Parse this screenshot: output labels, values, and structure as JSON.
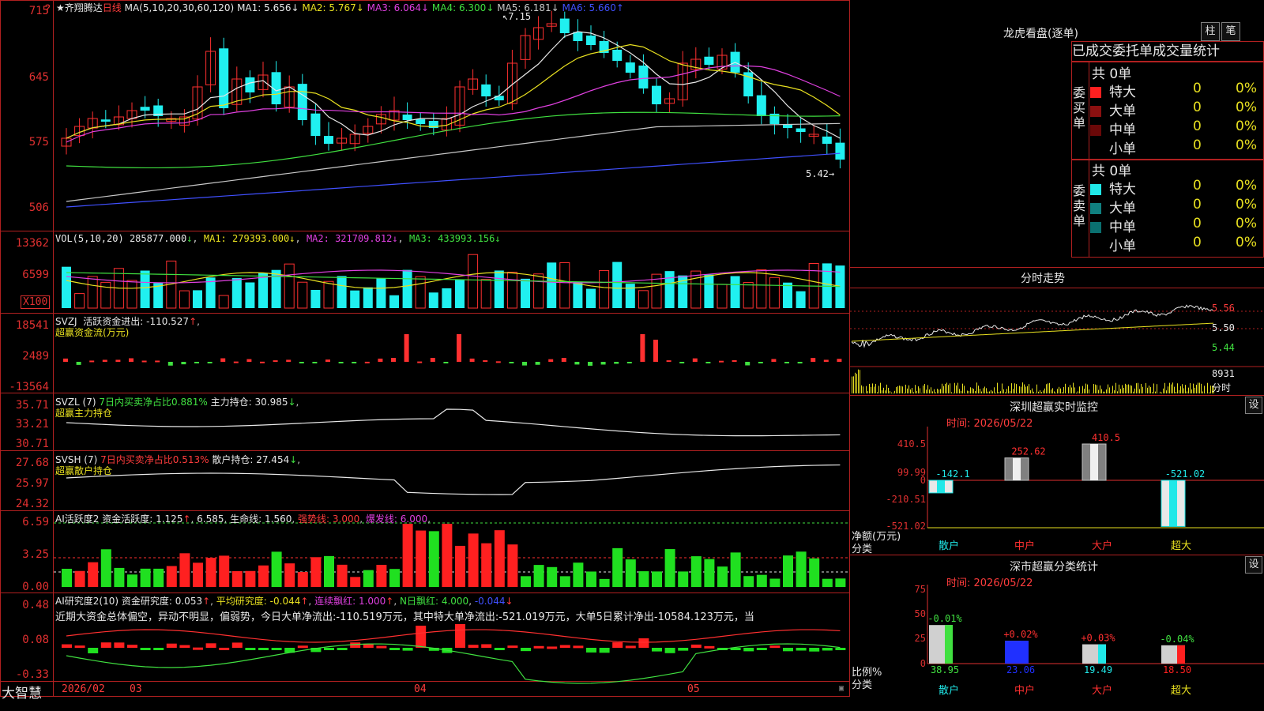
{
  "main_chart": {
    "title": "★齐翔腾达",
    "period": "日线",
    "ma_label": "MA(5,10,20,30,60,120)",
    "ma": [
      {
        "name": "MA1",
        "value": "5.656",
        "arrow": "↓",
        "color": "#e8e8e8"
      },
      {
        "name": "MA2",
        "value": "5.767",
        "arrow": "↓",
        "color": "#e8e020"
      },
      {
        "name": "MA3",
        "value": "6.064",
        "arrow": "↓",
        "color": "#e040e0"
      },
      {
        "name": "MA4",
        "value": "6.300",
        "arrow": "↓",
        "color": "#40e040"
      },
      {
        "name": "MA5",
        "value": "6.181",
        "arrow": "↓",
        "color": "#c8c8c8"
      },
      {
        "name": "MA6",
        "value": "5.660",
        "arrow": "↑",
        "color": "#4050ff"
      }
    ],
    "y_ticks": [
      "715",
      "645",
      "575",
      "506"
    ],
    "high_mark": "7.15",
    "low_mark": "5.42→",
    "question": "?"
  },
  "vol": {
    "label": "VOL(5,10,20)",
    "value": "285877.000",
    "ma1": "279393.000",
    "ma2": "321709.812",
    "ma3": "433993.156",
    "y_ticks": [
      "13362",
      "6599"
    ],
    "unit": "X100"
  },
  "svzj": {
    "label": "SVZJ",
    "desc": "活跃资金进出:",
    "value": "-110.527",
    "sub": "超赢资金流(万元)",
    "y_ticks": [
      "18541",
      "2489",
      "-13564"
    ]
  },
  "svzl": {
    "label": "SVZL (7)",
    "desc": "7日内买卖净占比0.881%",
    "pos_label": "主力持仓:",
    "pos_value": "30.985",
    "sub": "超赢主力持仓",
    "y_ticks": [
      "35.71",
      "33.21",
      "30.71"
    ]
  },
  "svsh": {
    "label": "SVSH (7)",
    "desc": "7日内买卖净占比0.513%",
    "pos_label": "散户持仓:",
    "pos_value": "27.454",
    "sub": "超赢散户持仓",
    "y_ticks": [
      "27.68",
      "25.97",
      "24.32"
    ]
  },
  "ai_active": {
    "label": "AI活跃度2",
    "desc": "资金活跃度:",
    "value": "1.125",
    "v2": "6.585",
    "life_label": "生命线:",
    "life": "1.560",
    "strong": "强势线: 3.000",
    "burst": "爆发线: 6.000",
    "y_ticks": [
      "6.59",
      "3.25",
      "0.00"
    ]
  },
  "ai_research": {
    "label": "AI研究度2(10)",
    "desc": "资金研究度:",
    "value": "0.053",
    "avg_label": "平均研究度:",
    "avg": "-0.044",
    "red_label": "连续飘红:",
    "red": "1.000",
    "nred": "N日飘红: 4.000",
    "last": "-0.044",
    "text": "近期大资金总体偏空，异动不明显，偏弱势，今日大单净流出:-110.519万元，其中特大单净流出:-521.019万元，大单5日累计净出-10584.123万元，当",
    "y_ticks": [
      "0.48",
      "0.08",
      "-0.33"
    ]
  },
  "bottom": {
    "brand": "大智慧",
    "dates": [
      "2026/02",
      "03",
      "04",
      "05"
    ]
  },
  "right": {
    "panel_title": "龙虎看盘(逐单)",
    "btn1": "柱",
    "btn2": "笔",
    "tabs": [
      "已成交",
      "委托单",
      "成交量统计"
    ],
    "buy_title": "委买单",
    "sell_title": "委卖单",
    "total": "共 0单",
    "rows": [
      "特大",
      "大单",
      "中单",
      "小单"
    ],
    "zero": "0",
    "pct": "0%",
    "buy_colors": [
      "#ff2020",
      "#8b1010",
      "#6a0808",
      ""
    ],
    "sell_colors": [
      "#20e8e8",
      "#108080",
      "#0a7070",
      ""
    ],
    "time_title": "分时走势",
    "time_ticks": [
      "5.56",
      "5.50",
      "5.44"
    ],
    "time_vol": "8931",
    "time_vol_label": "分时",
    "monitor_title": "深圳超赢实时监控",
    "monitor_btn": "设",
    "time_label": "时间: 2026/05/22",
    "monitor_ticks": [
      "410.5",
      "99.99",
      "0",
      "-210.51",
      "-521.02"
    ],
    "monitor_values": [
      "-142.1",
      "252.62",
      "410.5",
      "-521.02"
    ],
    "monitor_ylabel": "净额(万元)",
    "class_label": "分类",
    "classes": [
      "散户",
      "中户",
      "大户",
      "超大"
    ],
    "stat_title": "深市超赢分类统计",
    "stat_ticks": [
      "75",
      "50",
      "25",
      "0"
    ],
    "stat_top": [
      "-0.01%",
      "+0.02%",
      "+0.03%",
      "-0.04%"
    ],
    "stat_bottom": [
      "38.95",
      "23.06",
      "19.49",
      "18.50"
    ],
    "stat_ylabel": "比例%"
  }
}
